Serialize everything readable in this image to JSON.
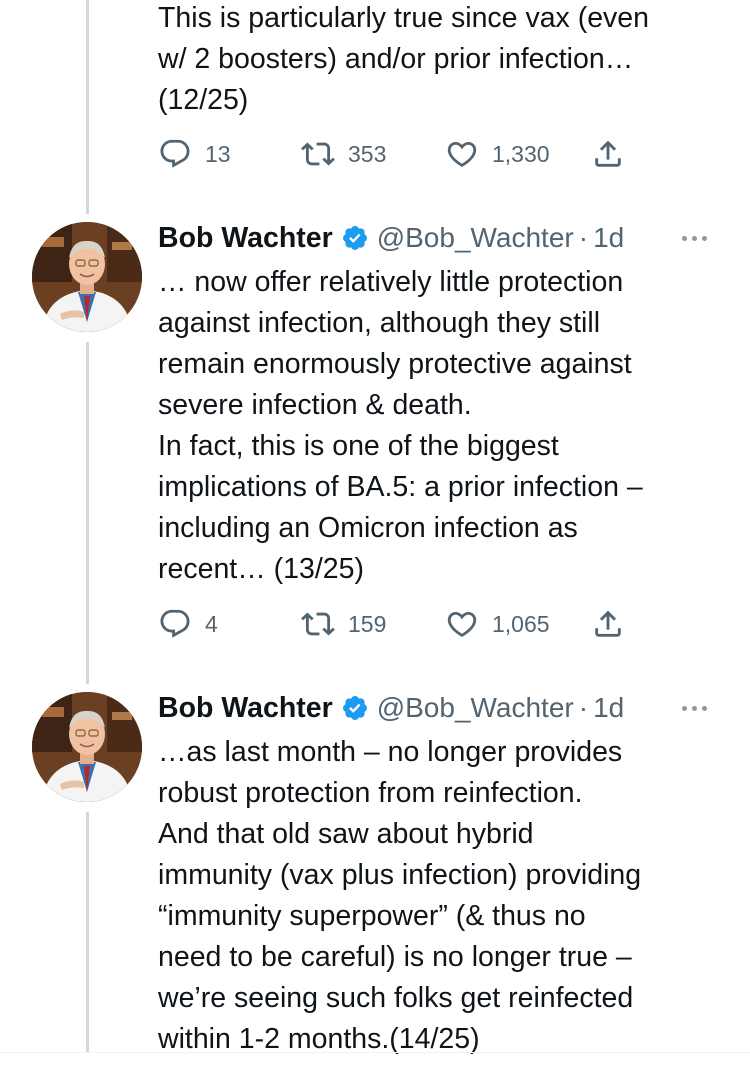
{
  "tweets": [
    {
      "text": "This is particularly true since vax (even\nw/ 2 boosters) and/or prior infection…\n(12/25)",
      "replies": "13",
      "retweets": "353",
      "likes": "1,330"
    },
    {
      "author": "Bob Wachter",
      "handle": "@Bob_Wachter",
      "time": "1d",
      "text": "… now offer relatively little protection\nagainst infection, although they still\nremain enormously protective against\nsevere infection & death.\nIn fact, this is one of the biggest\nimplications of BA.5: a prior infection –\nincluding an Omicron infection as\nrecent… (13/25)",
      "replies": "4",
      "retweets": "159",
      "likes": "1,065"
    },
    {
      "author": "Bob Wachter",
      "handle": "@Bob_Wachter",
      "time": "1d",
      "text": "…as last month – no longer provides\nrobust protection from reinfection.\nAnd that old saw about hybrid\nimmunity (vax plus infection) providing\n“immunity superpower” (& thus no\nneed to be careful) is no longer true –\nwe’re seeing such folks get reinfected\nwithin 1-2 months.(14/25)"
    }
  ],
  "separator": "·",
  "icons": {
    "reply": "reply-icon",
    "retweet": "retweet-icon",
    "like": "heart-icon",
    "share": "share-icon",
    "verified": "verified-badge-icon",
    "more": "more-options-icon"
  },
  "colors": {
    "text": "#0f1419",
    "secondary": "#536471",
    "verified": "#1d9bf0",
    "thread_line": "#cfd9de"
  }
}
